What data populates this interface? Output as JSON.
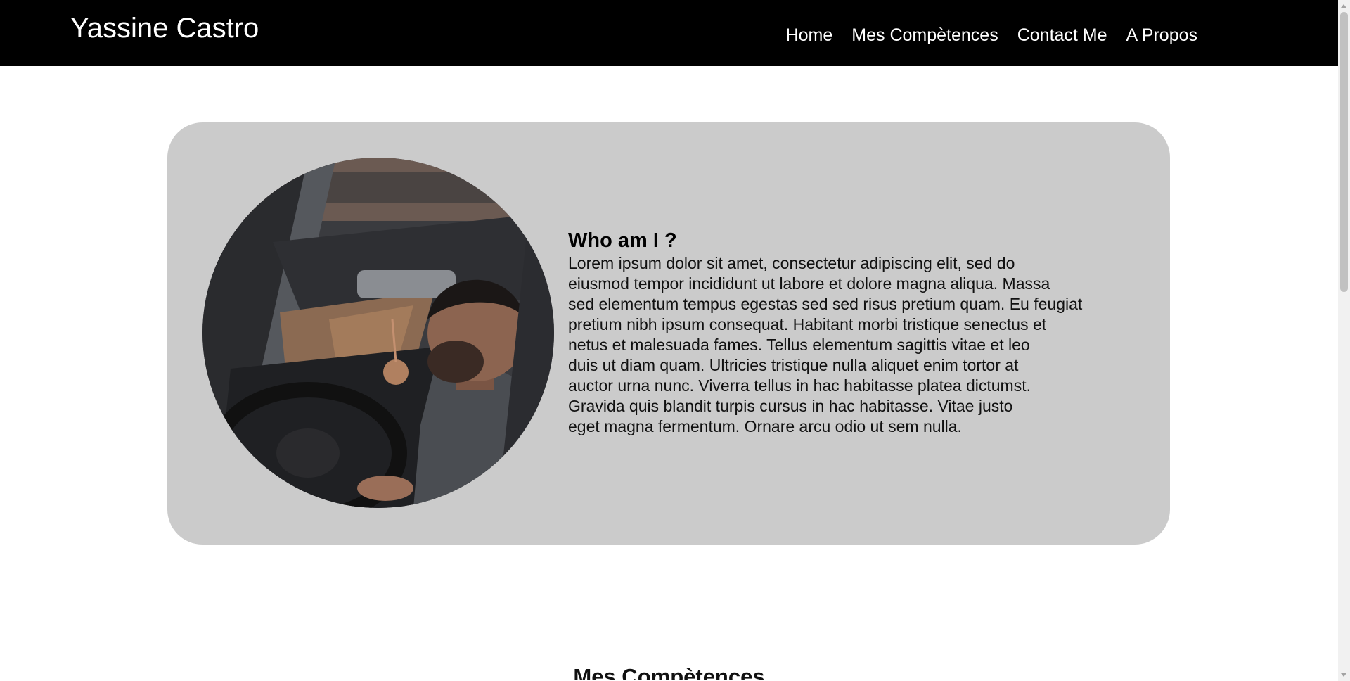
{
  "header": {
    "brand": "Yassine Castro",
    "nav": [
      {
        "label": "Home"
      },
      {
        "label": "Mes Compètences"
      },
      {
        "label": "Contact Me"
      },
      {
        "label": "A Propos"
      }
    ]
  },
  "about": {
    "heading": "Who am I ?",
    "lines": [
      "Lorem ipsum dolor sit amet, consectetur adipiscing elit, sed do",
      "eiusmod tempor incididunt ut labore et dolore magna aliqua. Massa",
      "sed elementum tempus egestas sed sed risus pretium quam. Eu feugiat",
      "pretium nibh ipsum consequat. Habitant morbi tristique senectus et",
      "netus et malesuada fames. Tellus elementum sagittis vitae et leo",
      "duis ut diam quam. Ultricies tristique nulla aliquet enim tortor at",
      "auctor urna nunc. Viverra tellus in hac habitasse platea dictumst.",
      "Gravida quis blandit turpis cursus in hac habitasse. Vitae justo",
      "eget magna fermentum. Ornare arcu odio ut sem nulla."
    ]
  },
  "skills_section": {
    "title": "Mes Compètences"
  },
  "colors": {
    "navbar": "#000000",
    "card": "#cbcbcb",
    "text": "#111111"
  }
}
